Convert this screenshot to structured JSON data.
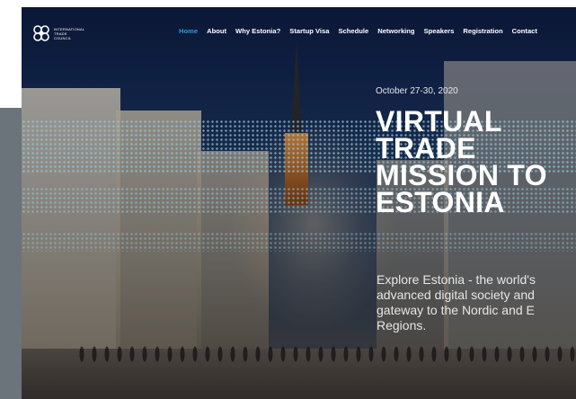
{
  "brand": {
    "logo_lines": [
      "INTERNATIONAL",
      "TRADE",
      "COUNCIL"
    ],
    "logo_icon": "flower-knot-icon"
  },
  "nav": {
    "items": [
      {
        "label": "Home",
        "active": true
      },
      {
        "label": "About",
        "active": false
      },
      {
        "label": "Why Estonia?",
        "active": false
      },
      {
        "label": "Startup Visa",
        "active": false
      },
      {
        "label": "Schedule",
        "active": false
      },
      {
        "label": "Networking",
        "active": false
      },
      {
        "label": "Speakers",
        "active": false
      },
      {
        "label": "Registration",
        "active": false
      },
      {
        "label": "Contact",
        "active": false
      }
    ],
    "active_color": "#2a9bd8"
  },
  "hero": {
    "date": "October 27-30, 2020",
    "title_lines": [
      "VIRTUAL",
      "TRADE",
      "MISSION TO",
      "ESTONIA"
    ],
    "description": "Explore Estonia - the world's\nadvanced digital society and\ngateway to the Nordic and E\nRegions."
  }
}
